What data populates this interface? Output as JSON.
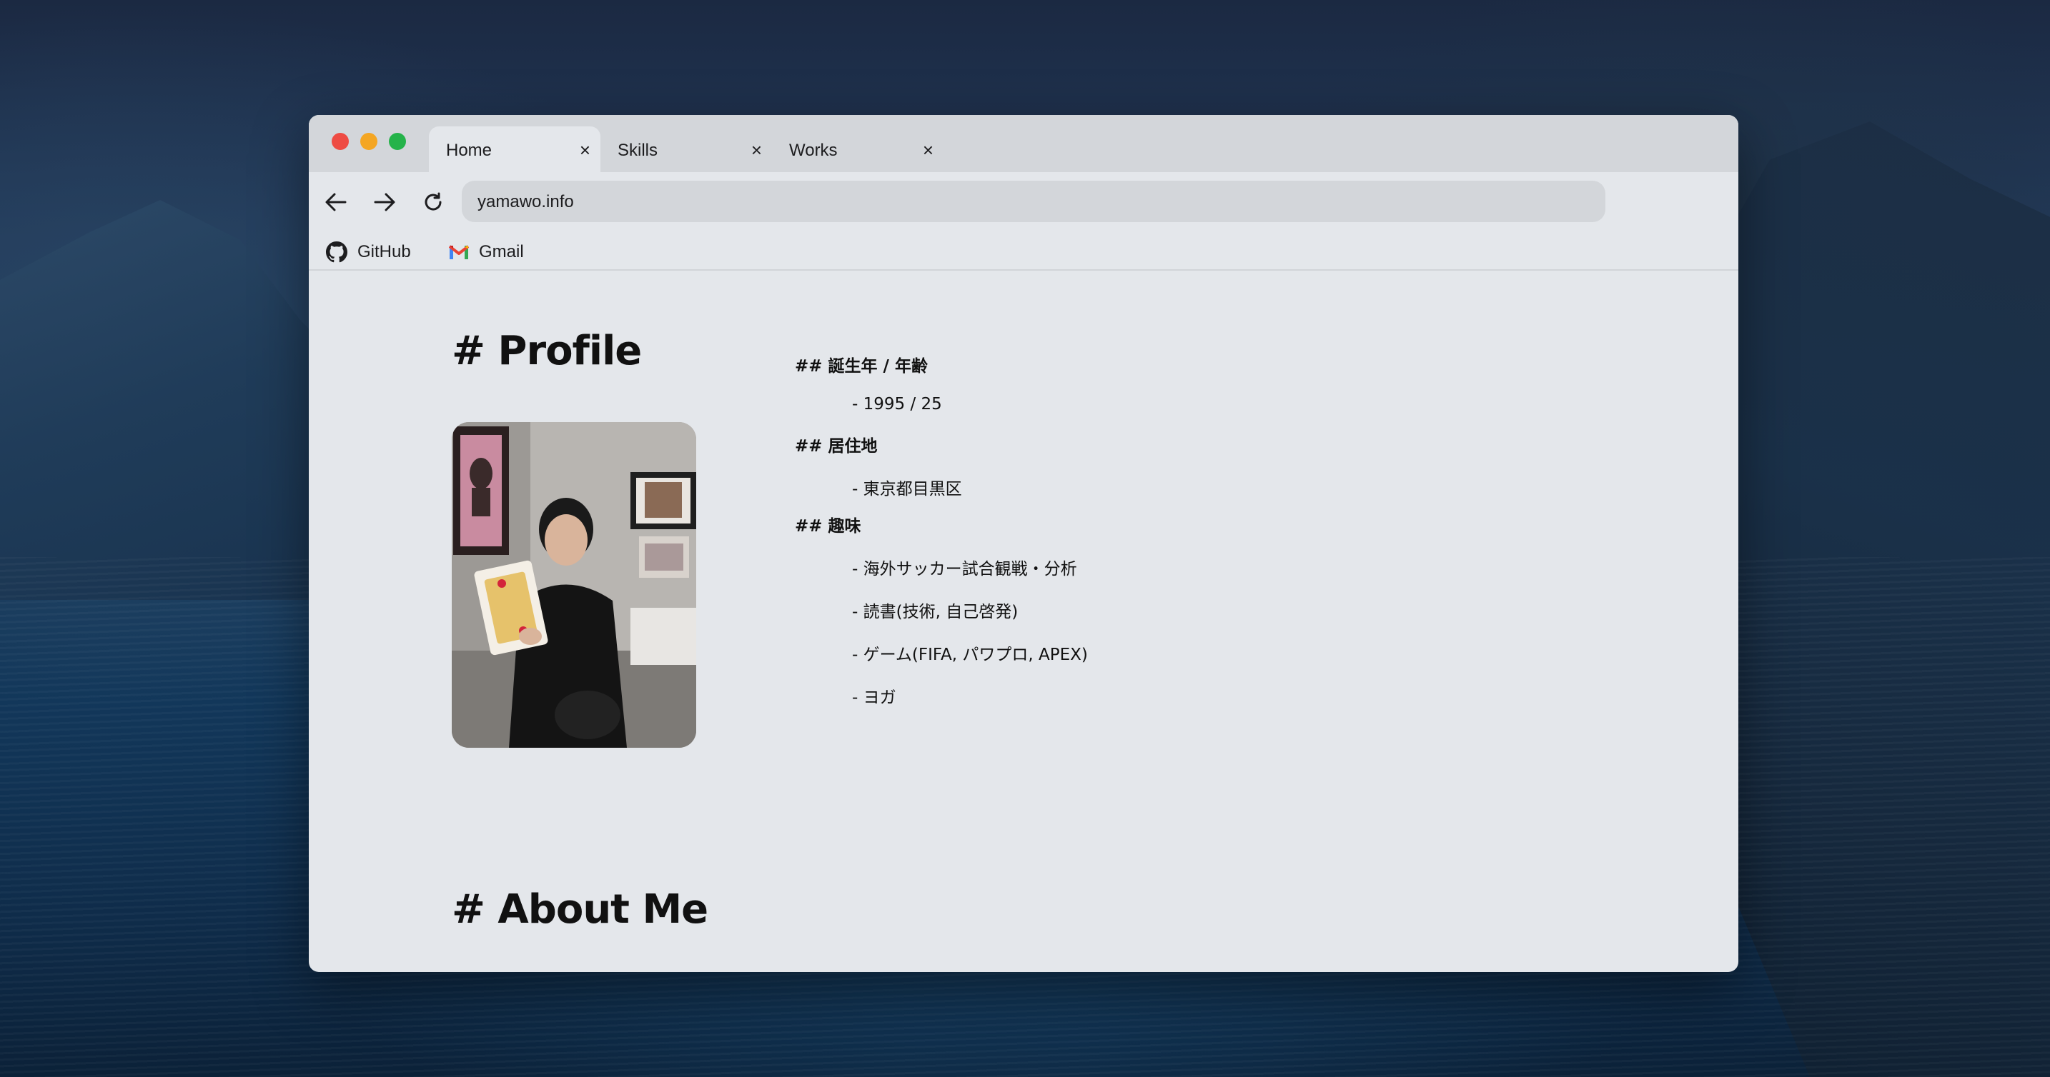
{
  "browser": {
    "tabs": [
      {
        "label": "Home",
        "close": "×"
      },
      {
        "label": "Skills",
        "close": "×"
      },
      {
        "label": "Works",
        "close": "×"
      }
    ],
    "address": "yamawo.info",
    "bookmarks": [
      {
        "label": "GitHub",
        "icon": "github-icon"
      },
      {
        "label": "Gmail",
        "icon": "gmail-icon"
      }
    ]
  },
  "page": {
    "profile_heading": "# Profile",
    "sections": [
      {
        "heading": "## 誕生年 / 年齢",
        "items": [
          "- 1995 / 25"
        ]
      },
      {
        "heading": "## 居住地",
        "items": [
          "- 東京都目黒区"
        ]
      },
      {
        "heading": "## 趣味",
        "items": [
          "- 海外サッカー試合観戦・分析",
          "- 読書(技術, 自己啓発)",
          "- ゲーム(FIFA, パワプロ, APEX)",
          "- ヨガ"
        ]
      }
    ],
    "about_heading": "# About Me"
  }
}
